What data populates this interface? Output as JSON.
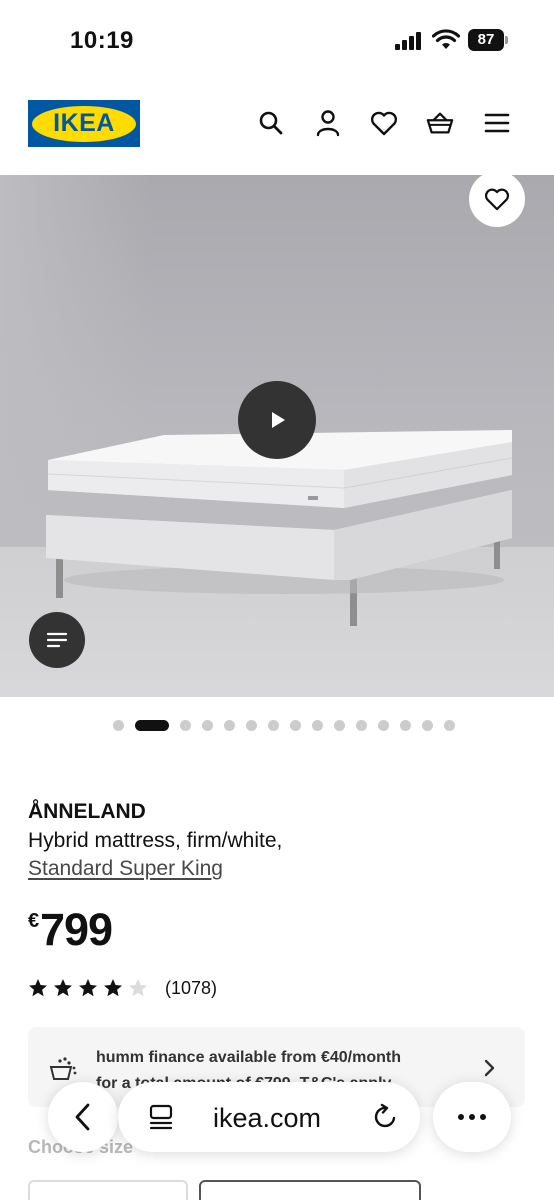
{
  "status_bar": {
    "time": "10:19",
    "battery": "87"
  },
  "header": {
    "logo_text": "IKEA",
    "icons": [
      "search-icon",
      "account-icon",
      "heart-icon",
      "basket-icon",
      "menu-icon"
    ],
    "brand_blue": "#0058a3",
    "brand_yellow": "#ffdb00"
  },
  "gallery": {
    "image_count": 15,
    "active_index": 1
  },
  "product": {
    "name": "ÅNNELAND",
    "description": "Hybrid mattress, firm/white,",
    "size": "Standard Super King",
    "currency": "€",
    "price": "799",
    "rating_value": 4,
    "rating_max": 5,
    "review_count": "(1078)"
  },
  "finance": {
    "line1": "humm finance available from €40/month",
    "line2": "for a total amount of €799. T&C's apply"
  },
  "size_section": {
    "label": "Choose size"
  },
  "browser": {
    "url": "ikea.com"
  }
}
